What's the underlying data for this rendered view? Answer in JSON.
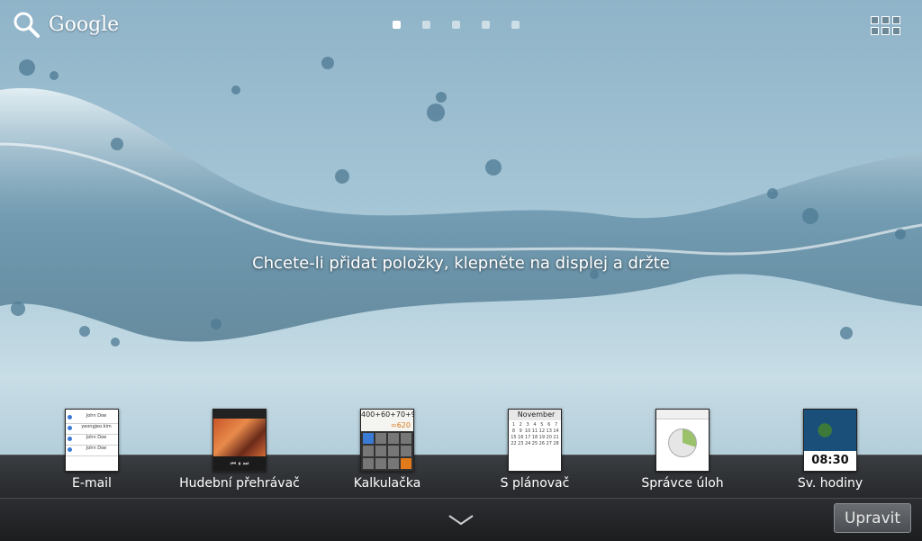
{
  "top_bar": {
    "search_label": "Google",
    "search_icon": "search-icon",
    "apps_icon": "apps-grid-icon",
    "page_count": 5,
    "active_page": 1
  },
  "hint": "Chcete-li přidat položky, klepněte na displej a držte",
  "dock": {
    "apps": [
      {
        "label": "E-mail",
        "icon": "email-app-icon"
      },
      {
        "label": "Hudební přehrávač",
        "icon": "music-player-app-icon"
      },
      {
        "label": "Kalkulačka",
        "icon": "calculator-app-icon"
      },
      {
        "label": "S plánovač",
        "icon": "calendar-app-icon"
      },
      {
        "label": "Správce úloh",
        "icon": "task-manager-app-icon"
      },
      {
        "label": "Sv. hodiny",
        "icon": "world-clock-app-icon"
      }
    ]
  },
  "thumbs": {
    "email_rows": [
      "John Doe",
      "yeongjeo.kim",
      "John Doe",
      "John Doe"
    ],
    "calc_display": "400+60+70+90",
    "calc_result": "=620",
    "calendar_month": "November",
    "clock_time": "08:30"
  },
  "bottom_bar": {
    "chevron_icon": "chevron-down-icon",
    "edit_label": "Upravit"
  },
  "colors": {
    "accent": "#3a7bd5",
    "wallpaper": "#a9c9d8",
    "dock": "#26282b"
  }
}
